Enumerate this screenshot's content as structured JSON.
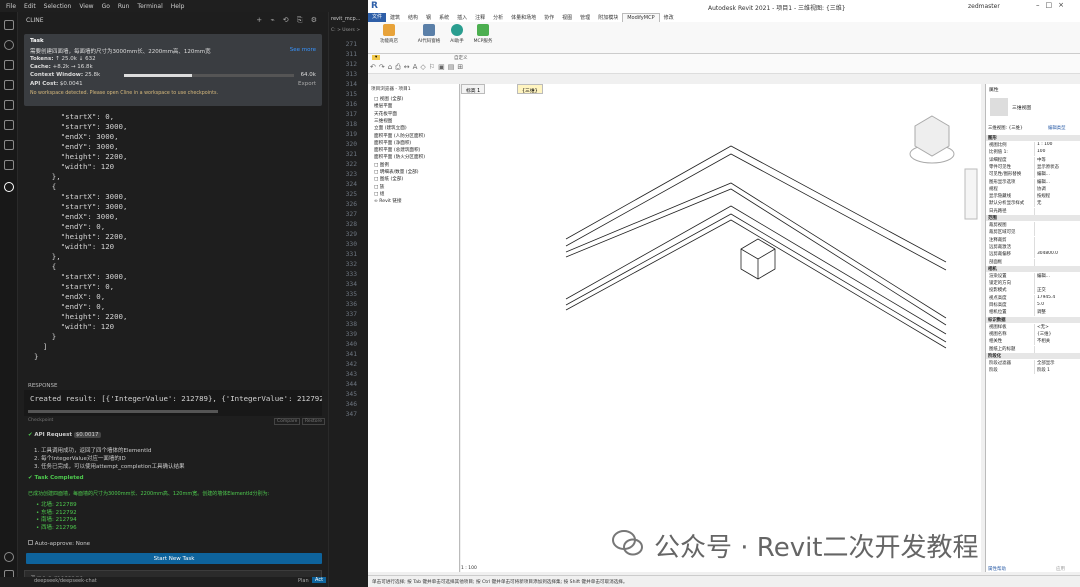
{
  "vscode": {
    "menu": [
      "File",
      "Edit",
      "Selection",
      "View",
      "Go",
      "Run",
      "Terminal",
      "Help"
    ],
    "panel_title": "CLINE",
    "task": {
      "label": "Task",
      "text": "需要创建四面墙，每面墙的尺寸为3000mm长、2200mm高、120mm宽",
      "see_more": "See more",
      "tokens_label": "Tokens:",
      "tokens_value": "↑ 25.0k ↓ 632",
      "cache_label": "Cache:",
      "cache_value": "+8.2k → 16.8k",
      "context_label": "Context Window:",
      "context_used": "25.8k",
      "context_max": "64.0k",
      "context_fraction": 0.4,
      "api_cost_label": "API Cost:",
      "api_cost_value": "$0.0041",
      "export_label": "Export",
      "warning": "No workspace detected. Please open Cline in a workspace to use checkpoints."
    },
    "code_lines": [
      "      \"startX\": 0,",
      "      \"startY\": 3000,",
      "      \"endX\": 3000,",
      "      \"endY\": 3000,",
      "      \"height\": 2200,",
      "      \"width\": 120",
      "    },",
      "    {",
      "      \"startX\": 3000,",
      "      \"startY\": 3000,",
      "      \"endX\": 3000,",
      "      \"endY\": 0,",
      "      \"height\": 2200,",
      "      \"width\": 120",
      "    },",
      "    {",
      "      \"startX\": 3000,",
      "      \"startY\": 0,",
      "      \"endX\": 0,",
      "      \"endY\": 0,",
      "      \"height\": 2200,",
      "      \"width\": 120",
      "    }",
      "  ]",
      "}"
    ],
    "response_label": "RESPONSE",
    "response_text": "Created result: [{'IntegerValue': 212789}, {'IntegerValue': 212792}, {'Int",
    "checkpoint_label": "Checkpoint",
    "compare_label": "Compare",
    "restore_label": "Restore",
    "api_request_label": "API Request",
    "api_request_cost": "$0.0017",
    "api_steps": [
      "1. 工具调用成功，返回了四个墙体的ElementId",
      "2. 每个IntegerValue对应一面墙的ID",
      "3. 任务已完成，可以使用attempt_completion工具确认结果"
    ],
    "task_completed_label": "Task Completed",
    "completed_text": "已成功创建四面墙，每面墙的尺寸为3000mm长、2200mm高、120mm宽。创建的墙体ElementId分别为:",
    "wall_ids": [
      "• 北墙: 212789",
      "• 东墙: 212792",
      "• 南墙: 212794",
      "• 西墙: 212796"
    ],
    "auto_approve_label": "Auto-approve:",
    "auto_approve_value": "None",
    "start_new_task": "Start New Task",
    "message_placeholder": "Type a message...",
    "model_label": "deepseek/deepseek-chat",
    "plan_label": "Plan",
    "act_label": "Act",
    "editor_tab": "revit_mcp...",
    "editor_breadcrumb": "C: > Users >",
    "line_numbers": [
      "271",
      "311",
      "312",
      "313",
      "314",
      "315",
      "316",
      "317",
      "318",
      "319",
      "320",
      "321",
      "322",
      "323",
      "324",
      "325",
      "326",
      "327",
      "328",
      "329",
      "330",
      "331",
      "332",
      "333",
      "334",
      "335",
      "336",
      "337",
      "338",
      "339",
      "340",
      "341",
      "342",
      "343",
      "344",
      "345",
      "346",
      "347"
    ]
  },
  "revit": {
    "window_title": "Autodesk Revit 2021 - 项目1 - 三维视图: {三维}",
    "user": "zedmaster",
    "tabs": [
      "文件",
      "建筑",
      "结构",
      "钢",
      "系统",
      "插入",
      "注释",
      "分析",
      "体量和场地",
      "协作",
      "视图",
      "管理",
      "附加模块",
      "修改"
    ],
    "active_tab": "ModifyMCP",
    "ribbon_buttons": [
      "功能商店",
      "AI代码窗格",
      "AI助手",
      "MCP服务"
    ],
    "ribbon_group": "自定义",
    "browser_title": "项目浏览器 - 项目1",
    "tree": [
      "□ 视图 (全部)",
      "  楼层平面",
      "  天花板平面",
      "  三维视图",
      "  立面 (建筑立面)",
      "  面积平面 (人防分区面积)",
      "  面积平面 (净面积)",
      "  面积平面 (总建筑面积)",
      "  面积平面 (防火分区面积)",
      "□ 图例",
      "□ 明细表/数量 (全部)",
      "□ 图纸 (全部)",
      "□ 族",
      "□ 组",
      "∞ Revit 链接"
    ],
    "view_tabs": [
      "标高 1",
      "{三维}"
    ],
    "properties_title": "属性",
    "view_type": "三维视图",
    "view_selector": "三维视图: {三维}",
    "edit_type": "编辑类型",
    "sections": [
      {
        "name": "图形",
        "rows": [
          [
            "视图比例",
            "1 : 100"
          ],
          [
            "比例值 1:",
            "100"
          ],
          [
            "详细程度",
            "中等"
          ],
          [
            "零件可见性",
            "显示原状态"
          ],
          [
            "可见性/图形替换",
            "编辑..."
          ],
          [
            "图形显示选项",
            "编辑..."
          ],
          [
            "规程",
            "协调"
          ],
          [
            "显示隐藏线",
            "按规程"
          ],
          [
            "默认分析显示样式",
            "无"
          ],
          [
            "日光路径",
            ""
          ]
        ]
      },
      {
        "name": "范围",
        "rows": [
          [
            "裁剪视图",
            ""
          ],
          [
            "裁剪区域可见",
            ""
          ],
          [
            "注释裁剪",
            ""
          ],
          [
            "远剪裁激活",
            ""
          ],
          [
            "远剪裁偏移",
            "304800.0"
          ],
          [
            "剖面框",
            ""
          ]
        ]
      },
      {
        "name": "相机",
        "rows": [
          [
            "渲染设置",
            "编辑..."
          ],
          [
            "锁定的方向",
            ""
          ],
          [
            "投影模式",
            "正交"
          ],
          [
            "视点高度",
            "17945.4"
          ],
          [
            "目标高度",
            "5.0"
          ],
          [
            "相机位置",
            "调整"
          ]
        ]
      },
      {
        "name": "标识数据",
        "rows": [
          [
            "视图样板",
            "<无>"
          ],
          [
            "视图名称",
            "{三维}"
          ],
          [
            "相关性",
            "不相关"
          ],
          [
            "图纸上的标题",
            ""
          ]
        ]
      },
      {
        "name": "阶段化",
        "rows": [
          [
            "阶段过滤器",
            "全部显示"
          ],
          [
            "阶段",
            "阶段 1"
          ]
        ]
      }
    ],
    "properties_help": "属性帮助",
    "apply": "应用",
    "scale": "1 : 100",
    "status": "单击可进行选择; 按 Tab 键并单击可选择其他项目; 按 Ctrl 键并单击可将新项目添加到选择集; 按 Shift 键并单击可取消选择。"
  },
  "watermark": "公众号 · Revit二次开发教程",
  "colors": {
    "vs_bg": "#1e1e1e",
    "accent": "#0e639c",
    "revit_blue": "#2e5fa8",
    "green": "#4ec94e"
  }
}
